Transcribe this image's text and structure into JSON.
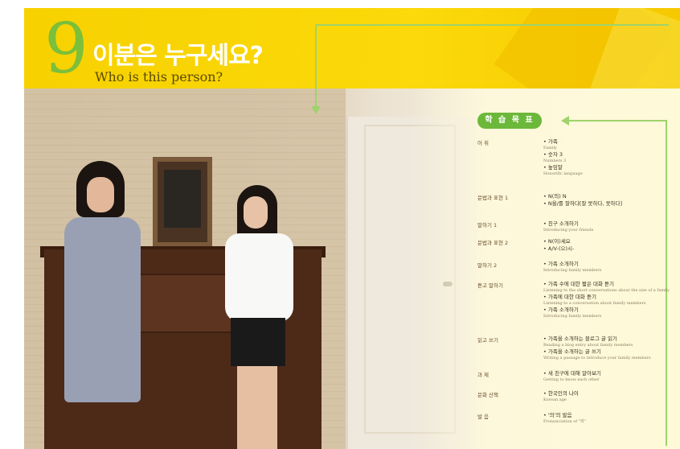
{
  "header": {
    "chapter_number": "9",
    "title_ko": "이분은 누구세요?",
    "title_en": "Who is this person?"
  },
  "goals_label": "학 습 목 표",
  "goals": [
    {
      "category": "어 휘",
      "items": [
        {
          "ko": "• 가족",
          "en": "Family"
        },
        {
          "ko": "• 숫자 3",
          "en": "Numbers 3"
        },
        {
          "ko": "• 높임말",
          "en": "Honorific language"
        }
      ]
    },
    {
      "category": "문법과 표현 1",
      "items": [
        {
          "ko": "• N(의) N",
          "en": ""
        },
        {
          "ko": "• N을/를 잘하다[잘 못하다, 못하다]",
          "en": ""
        }
      ]
    },
    {
      "category": "말하기 1",
      "items": [
        {
          "ko": "• 친구 소개하기",
          "en": "Introducing your friends"
        }
      ]
    },
    {
      "category": "문법과 표현 2",
      "items": [
        {
          "ko": "• N(이)세요",
          "en": ""
        },
        {
          "ko": "• A/V-(으)시-",
          "en": ""
        }
      ]
    },
    {
      "category": "말하기 2",
      "items": [
        {
          "ko": "• 가족 소개하기",
          "en": "Introducing family members"
        }
      ]
    },
    {
      "category": "듣고 말하기",
      "items": [
        {
          "ko": "• 가족 수에 대한 짧은 대화 듣기",
          "en": "Listening to the short conversations about the size of a family"
        },
        {
          "ko": "• 가족에 대한 대화 듣기",
          "en": "Listening to a conversation about family members"
        },
        {
          "ko": "• 가족 소개하기",
          "en": "Introducing family members"
        }
      ]
    },
    {
      "category": "읽고 쓰기",
      "items": [
        {
          "ko": "• 가족을 소개하는 블로그 글 읽기",
          "en": "Reading a blog entry about family members"
        },
        {
          "ko": "• 가족을 소개하는 글 쓰기",
          "en": "Writing a passage to introduce your family members"
        }
      ]
    },
    {
      "category": "과 제",
      "items": [
        {
          "ko": "• 새 친구에 대해 알아보기",
          "en": "Getting to know each other"
        }
      ]
    },
    {
      "category": "문화 산책",
      "items": [
        {
          "ko": "• 한국인의 나이",
          "en": "Korean age"
        }
      ]
    },
    {
      "category": "발 음",
      "items": [
        {
          "ko": "• '의'의 발음",
          "en": "Pronunciation of \"의\""
        }
      ]
    }
  ],
  "colors": {
    "banner": "#f7d100",
    "accent_green": "#6cb83a",
    "chapter_number": "#7bbf3a"
  }
}
